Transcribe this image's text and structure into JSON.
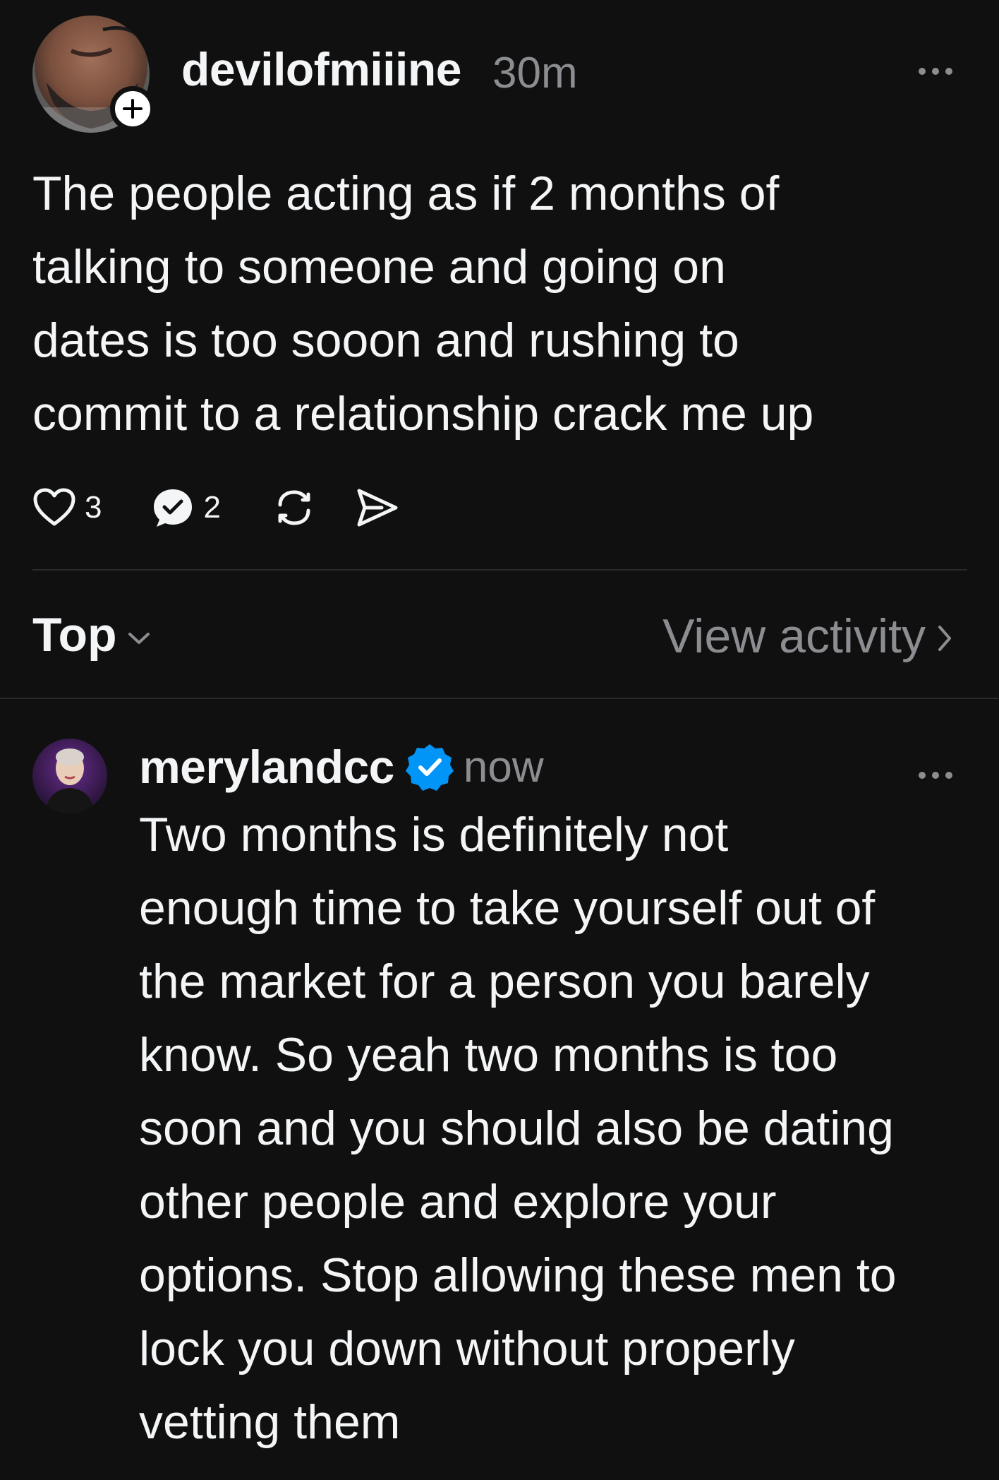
{
  "post": {
    "author": {
      "username": "devilofmiiine",
      "avatar_icon": "profile-photo",
      "follow_icon": "plus-icon"
    },
    "timestamp": "30m",
    "more_icon": "more-horizontal-icon",
    "body": "The people acting as if 2 months of\ntalking to someone and going on\ndates is too sooon and rushing to\ncommit to a relationship crack me up",
    "actions": {
      "like": {
        "icon": "heart-icon",
        "count": "3"
      },
      "reply": {
        "icon": "reply-bubble-check-icon",
        "count": "2"
      },
      "repost": {
        "icon": "repost-icon"
      },
      "share": {
        "icon": "send-icon"
      }
    }
  },
  "sort_bar": {
    "sort_label": "Top",
    "sort_icon": "chevron-down-icon",
    "activity_label": "View activity",
    "activity_icon": "chevron-right-icon"
  },
  "reply": {
    "author": {
      "username": "merylandcc",
      "verified": true,
      "avatar_icon": "profile-photo"
    },
    "timestamp": "now",
    "more_icon": "more-horizontal-icon",
    "body": "Two months is definitely not\nenough time to take yourself out of\nthe market for a person you barely\nknow. So yeah two months is too\nsoon and you should also be dating\nother people and explore your\noptions. Stop allowing these men to\nlock you down without properly\nvetting them"
  },
  "colors": {
    "background": "#101010",
    "text_primary": "#f3f5f7",
    "text_secondary": "#8b8d91",
    "verified_blue": "#0095f6",
    "divider": "#2a2a2a"
  }
}
